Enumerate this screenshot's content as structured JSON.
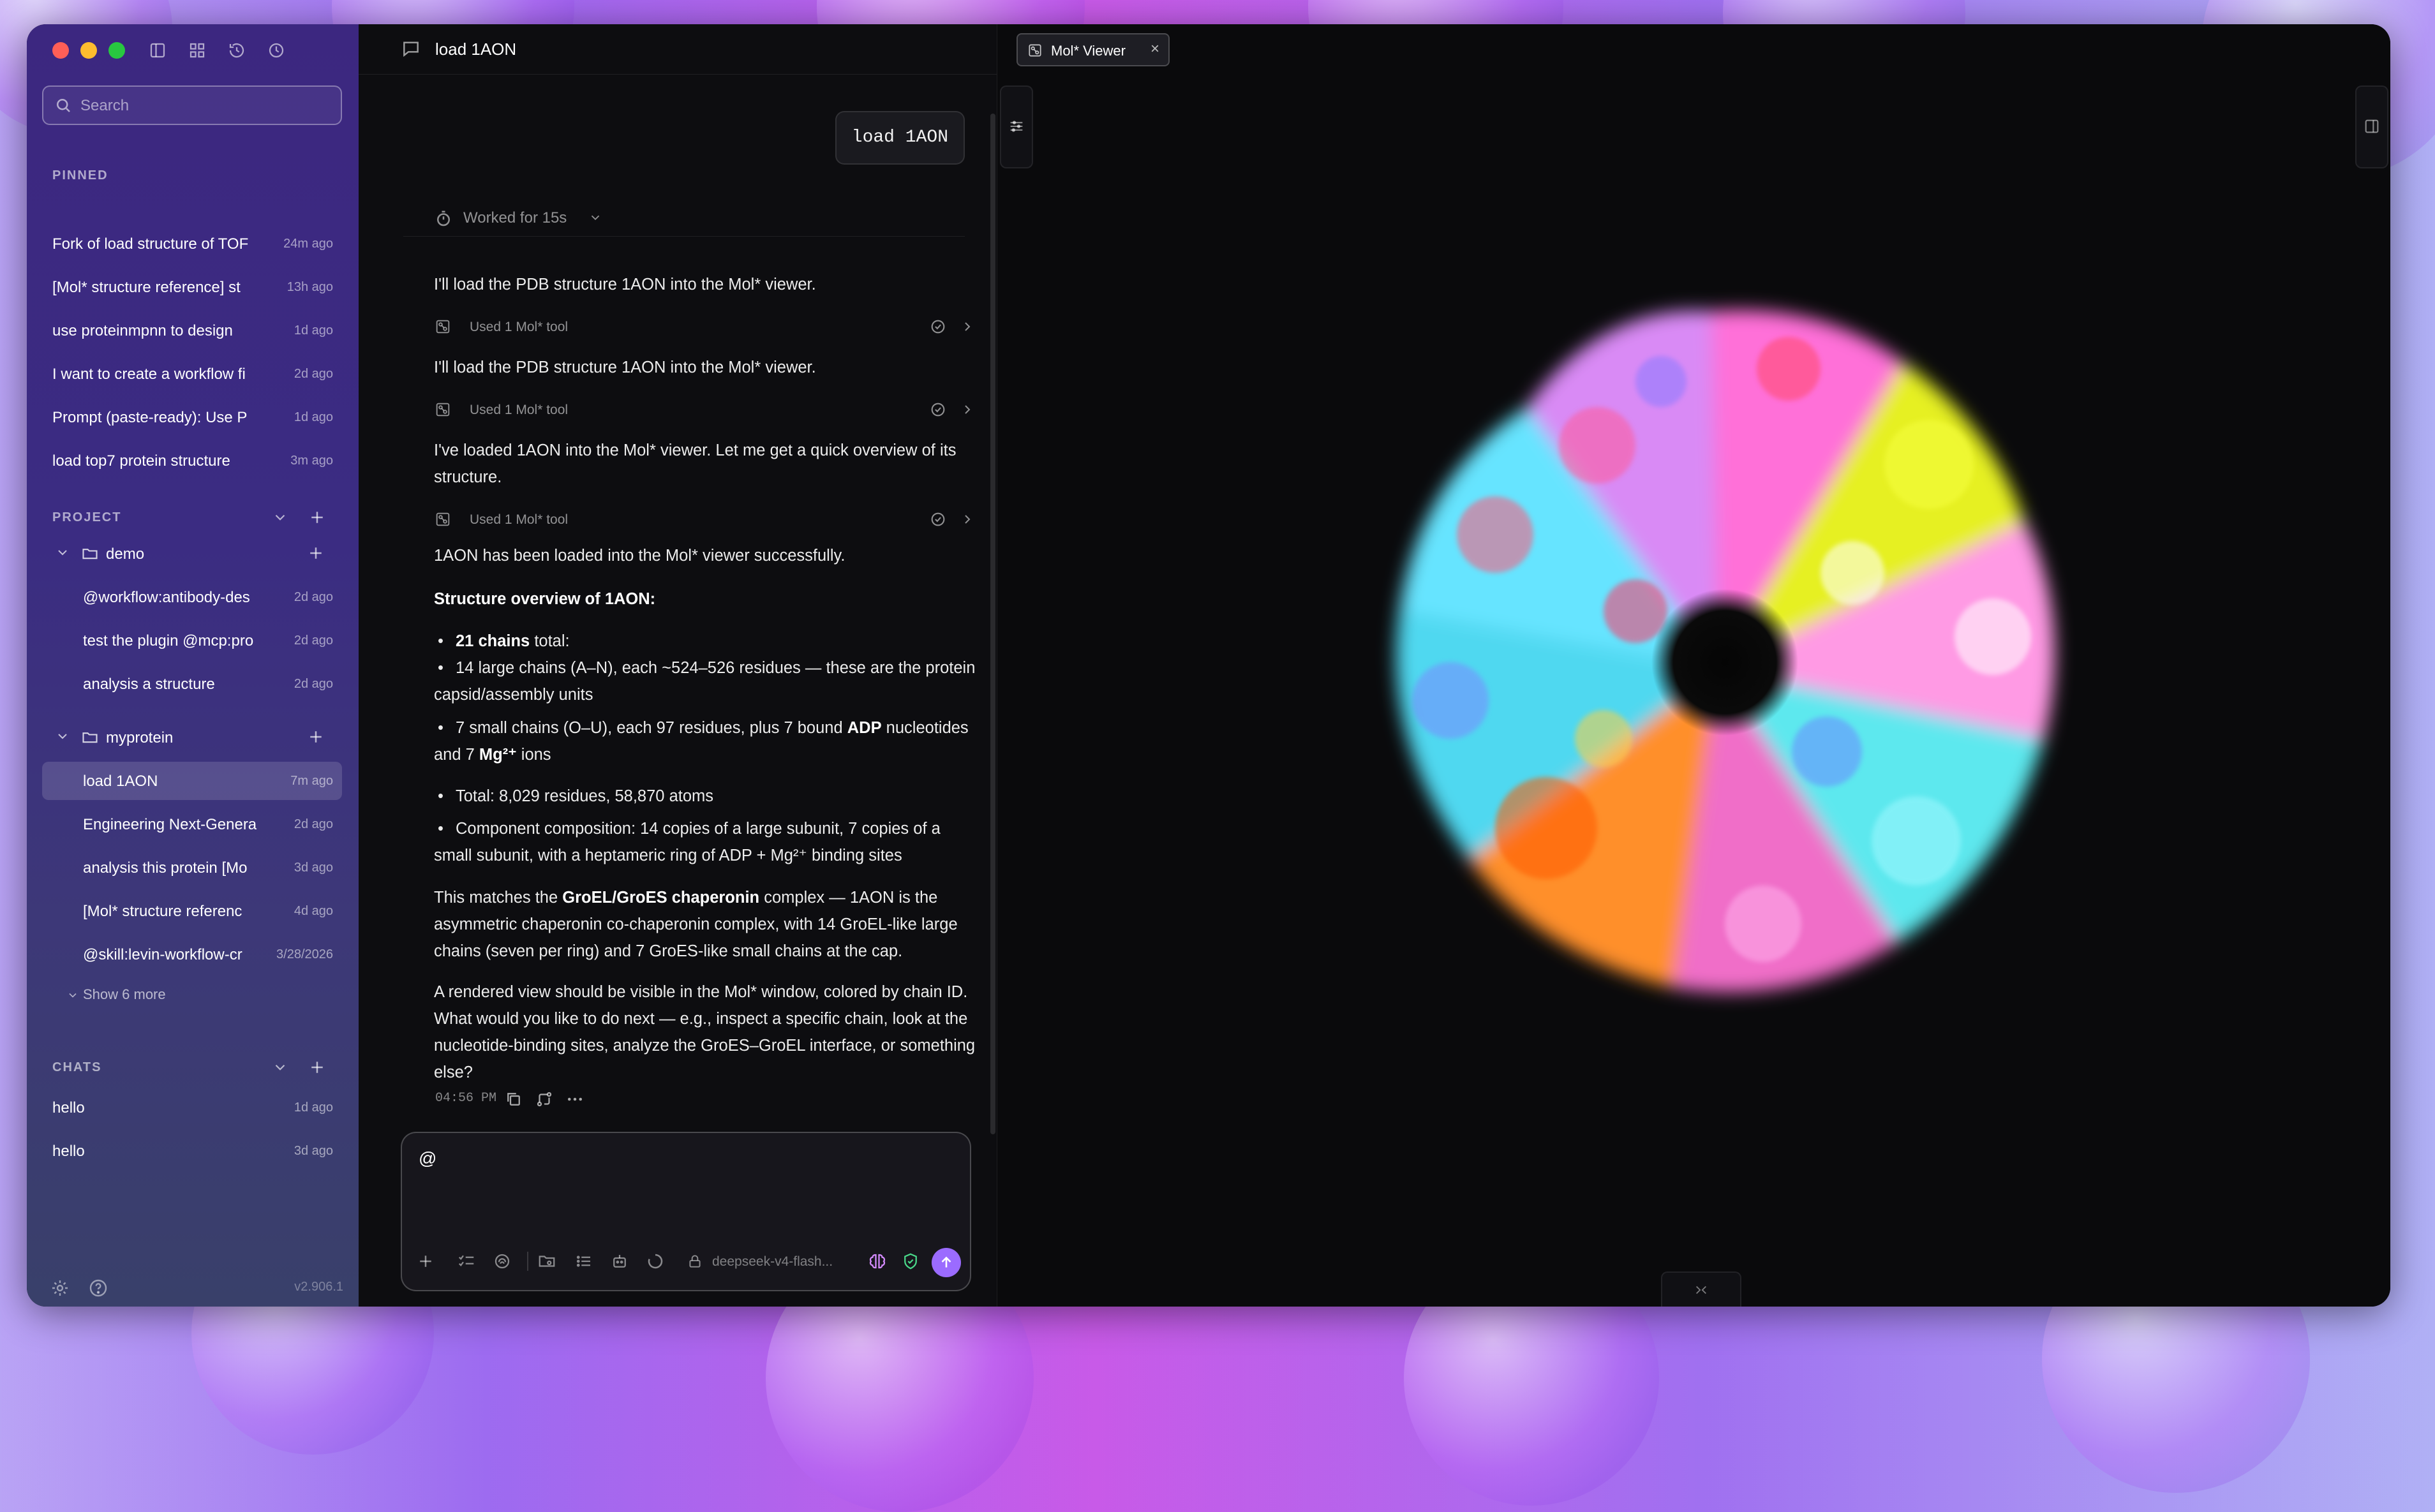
{
  "window": {
    "title": "load 1AON"
  },
  "sidebar": {
    "search_placeholder": "Search",
    "pinned_title": "PINNED",
    "pinned": [
      {
        "label": "Fork of load structure of TOF",
        "time": "24m ago"
      },
      {
        "label": "[Mol* structure reference] st",
        "time": "13h ago"
      },
      {
        "label": "use proteinmpnn to design",
        "time": "1d ago"
      },
      {
        "label": "I want to create a workflow fi",
        "time": "2d ago"
      },
      {
        "label": "Prompt (paste-ready): Use P",
        "time": "1d ago"
      },
      {
        "label": "load top7 protein structure",
        "time": "3m ago"
      }
    ],
    "project_title": "PROJECT",
    "folders": [
      {
        "name": "demo",
        "items": [
          {
            "label": "@workflow:antibody-des",
            "time": "2d ago"
          },
          {
            "label": "test the plugin @mcp:pro",
            "time": "2d ago"
          },
          {
            "label": "analysis a structure",
            "time": "2d ago"
          }
        ]
      },
      {
        "name": "myprotein",
        "items": [
          {
            "label": "load 1AON",
            "time": "7m ago"
          },
          {
            "label": "Engineering Next-Genera",
            "time": "2d ago"
          },
          {
            "label": "analysis this protein [Mo",
            "time": "3d ago"
          },
          {
            "label": "[Mol* structure referenc",
            "time": "4d ago"
          },
          {
            "label": "@skill:levin-workflow-cr",
            "time": "3/28/2026"
          }
        ]
      }
    ],
    "show_more": "Show 6 more",
    "chats_title": "CHATS",
    "chats": [
      {
        "label": "hello",
        "time": "1d ago"
      },
      {
        "label": "hello",
        "time": "3d ago"
      }
    ],
    "version": "v2.906.1"
  },
  "chat": {
    "user_message": "load 1AON",
    "worked": "Worked for 15s",
    "tool_label": "Used 1 Mol* tool",
    "msg1": "I'll load the PDB structure 1AON into the Mol* viewer.",
    "msg2": "I'll load the PDB structure 1AON into the Mol* viewer.",
    "msg3": "I've loaded 1AON into the Mol* viewer. Let me get a quick overview of its structure.",
    "msg4": "1AON has been loaded into the Mol* viewer successfully.",
    "overview_heading": "Structure overview of 1AON:",
    "b1_bold": "21 chains",
    "b1_rest": " total:",
    "b2": "14 large chains (A–N), each ~524–526 residues — these are the protein capsid/assembly units",
    "b3_pre": "7 small chains (O–U), each 97 residues, plus 7 bound ",
    "b3_bold1": "ADP",
    "b3_mid": " nucleotides and 7 ",
    "b3_bold2": "Mg²⁺",
    "b3_post": " ions",
    "b4": "Total: 8,029 residues, 58,870 atoms",
    "b5": "Component composition: 14 copies of a large subunit, 7 copies of a small subunit, with a heptameric ring of ADP + Mg²⁺ binding sites",
    "p1_pre": "This matches the ",
    "p1_bold": "GroEL/GroES chaperonin",
    "p1_post": " complex — 1AON is the asymmetric chaperonin co-chaperonin complex, with 14 GroEL-like large chains (seven per ring) and 7 GroES-like small chains at the cap.",
    "p2": "A rendered view should be visible in the Mol* window, colored by chain ID. What would you like to do next — e.g., inspect a specific chain, look at the nucleotide-binding sites, analyze the GroES–GroEL interface, or something else?",
    "timestamp": "04:56 PM",
    "composer_value": "@",
    "model": "deepseek-v4-flash..."
  },
  "viewer": {
    "tab_label": "Mol* Viewer",
    "close": "×"
  },
  "colors": {
    "accent": "#9b6bff",
    "sidebar_bg": "#3c2780",
    "window_bg": "#0d0d10"
  }
}
